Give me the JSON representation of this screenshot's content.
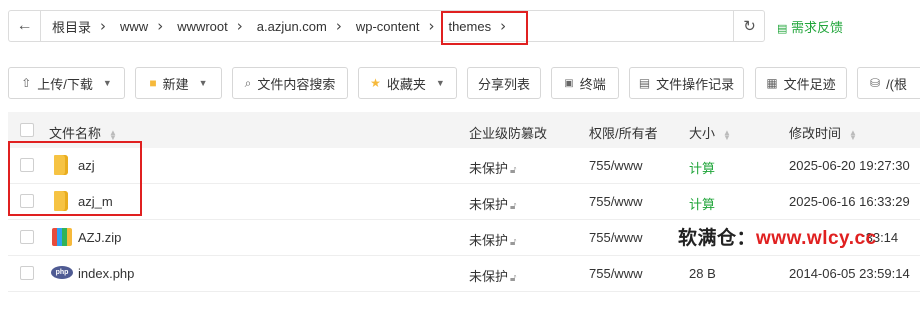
{
  "breadcrumb": [
    "根目录",
    "www",
    "wwwroot",
    "a.azjun.com",
    "wp-content",
    "themes"
  ],
  "feedback_label": "需求反馈",
  "toolbar": {
    "upload": "上传/下载",
    "new": "新建",
    "search_content": "文件内容搜索",
    "favorites": "收藏夹",
    "share_list": "分享列表",
    "terminal": "终端",
    "op_log": "文件操作记录",
    "footprint": "文件足迹",
    "disk": "/(根"
  },
  "table": {
    "headers": {
      "name": "文件名称",
      "tamper": "企业级防篡改",
      "perm": "权限/所有者",
      "size": "大小",
      "mtime": "修改时间"
    },
    "rows": [
      {
        "name": "azj",
        "icon": "folder-icon",
        "tamper": "未保护",
        "perm": "755/www",
        "size": "计算",
        "mtime": "2025-06-20 19:27:30"
      },
      {
        "name": "azj_m",
        "icon": "folder-icon",
        "tamper": "未保护",
        "perm": "755/www",
        "size": "计算",
        "mtime": "2025-06-16 16:33:29"
      },
      {
        "name": "AZJ.zip",
        "icon": "zip-icon",
        "tamper": "未保护",
        "perm": "755/www",
        "size": "",
        "mtime": ":33:14"
      },
      {
        "name": "index.php",
        "icon": "php-icon",
        "tamper": "未保护",
        "perm": "755/www",
        "size": "28 B",
        "mtime": "2014-06-05 23:59:14"
      }
    ]
  },
  "watermark": {
    "prefix": "软满仓：",
    "domain": "www.wlcy.cc"
  },
  "colors": {
    "accent_green": "#20a53a",
    "highlight_red": "#e02020"
  }
}
